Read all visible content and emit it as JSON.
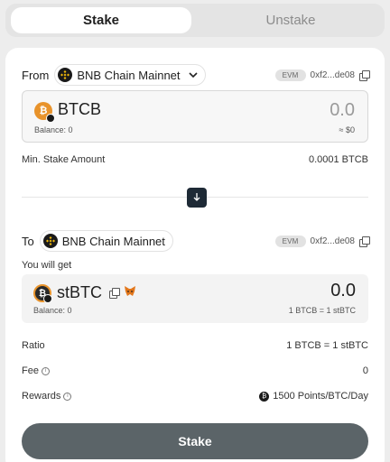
{
  "tabs": [
    {
      "label": "Stake",
      "active": true
    },
    {
      "label": "Unstake",
      "active": false
    }
  ],
  "from": {
    "label": "From",
    "chain": "BNB Chain Mainnet",
    "evm_badge": "EVM",
    "address": "0xf2...de08",
    "token": "BTCB",
    "amount": "0.0",
    "balance": "Balance: 0",
    "usd": "≈ $0"
  },
  "min_stake": {
    "label": "Min. Stake Amount",
    "value": "0.0001 BTCB"
  },
  "to": {
    "label": "To",
    "chain": "BNB Chain Mainnet",
    "evm_badge": "EVM",
    "address": "0xf2...de08",
    "you_will_get": "You will get",
    "token": "stBTC",
    "amount": "0.0",
    "balance": "Balance: 0",
    "rate": "1 BTCB = 1 stBTC"
  },
  "details": {
    "ratio_label": "Ratio",
    "ratio_value": "1 BTCB = 1 stBTC",
    "fee_label": "Fee",
    "fee_value": "0",
    "rewards_label": "Rewards",
    "rewards_value": "1500 Points/BTC/Day"
  },
  "stake_button": "Stake",
  "colors": {
    "accent": "#1e2a36",
    "button": "#5b6468",
    "btc_orange": "#e8932b",
    "bnb_yellow": "#f0b90b"
  },
  "icons": [
    "bnb-chain-icon",
    "btcb-token-icon",
    "stbtc-token-icon",
    "copy-icon",
    "metamask-fox-icon",
    "arrow-down-icon",
    "info-icon",
    "points-icon",
    "chevron-down-icon"
  ]
}
